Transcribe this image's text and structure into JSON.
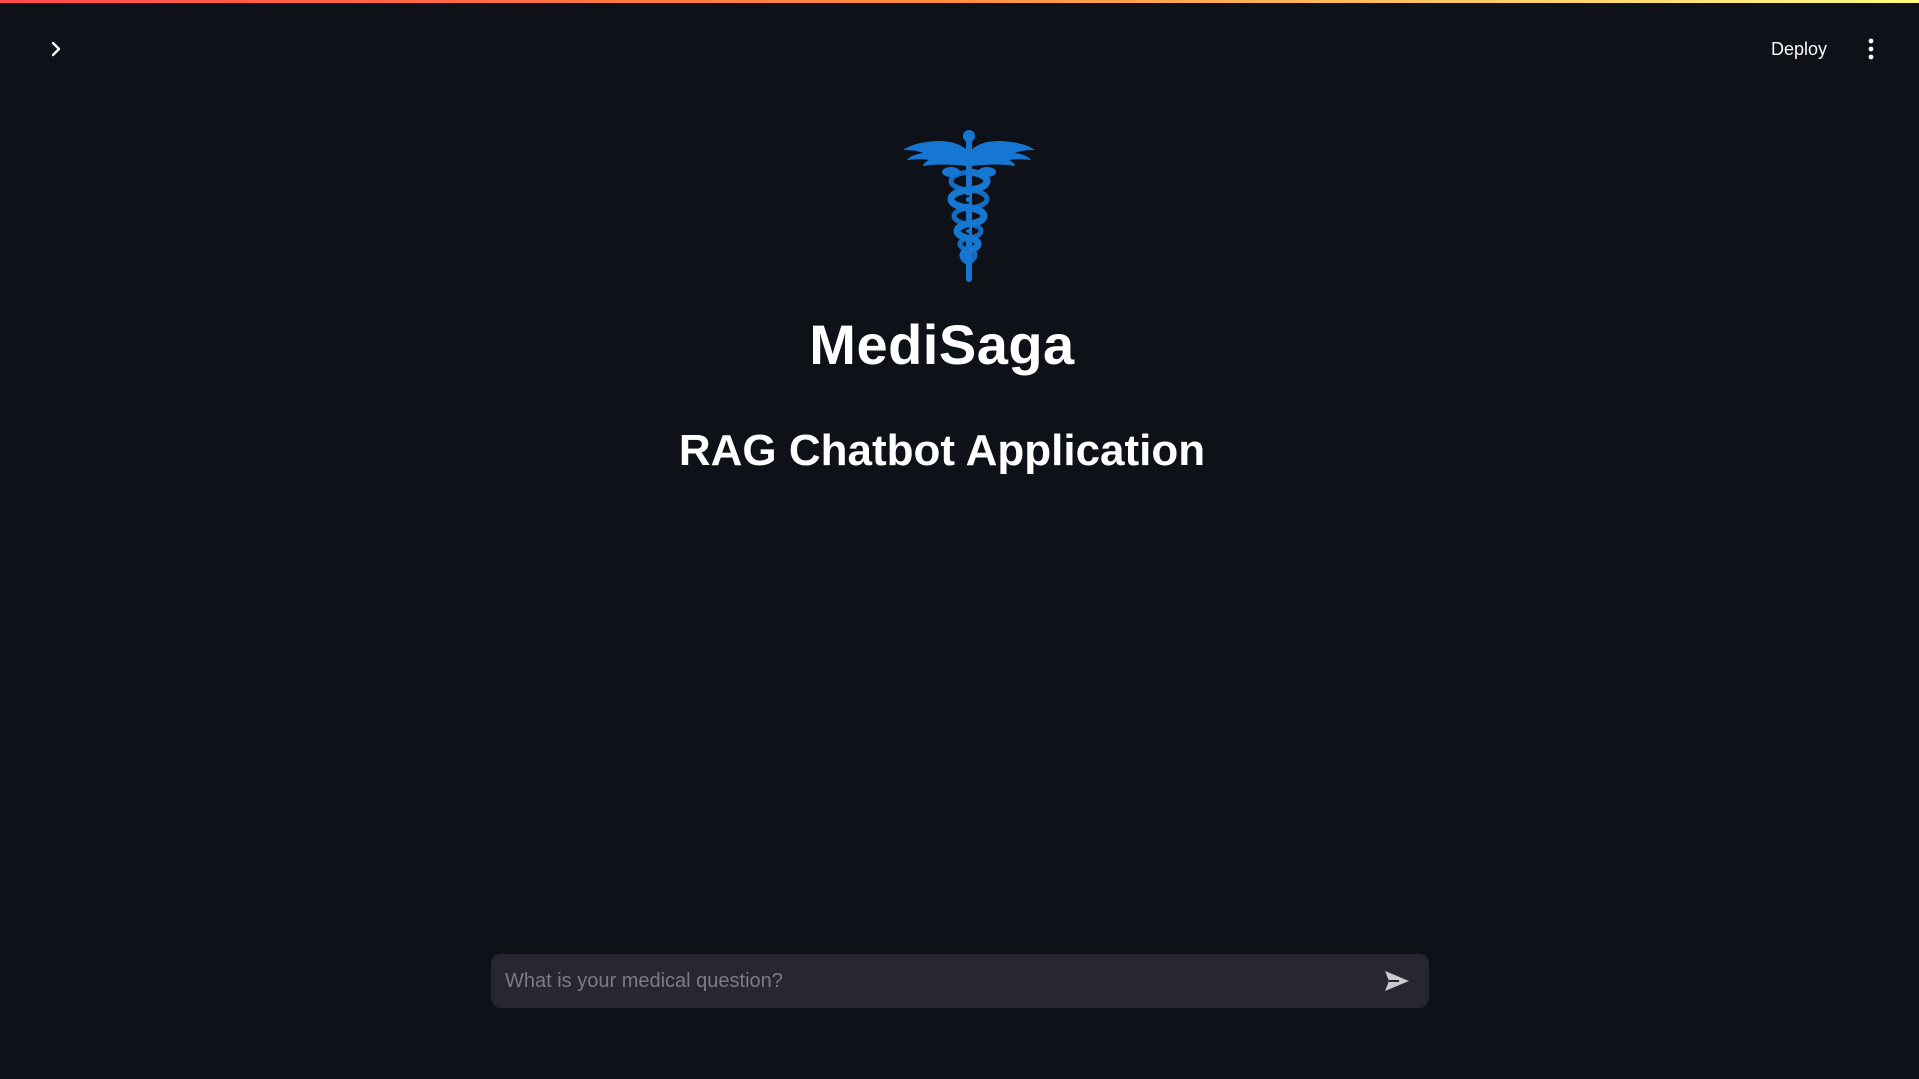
{
  "header": {
    "deploy_label": "Deploy",
    "sidebar_toggle_icon": "chevron-right-icon",
    "menu_icon": "kebab-menu-icon"
  },
  "main": {
    "logo_icon": "caduceus-icon",
    "title": "MediSaga",
    "subtitle": "RAG Chatbot Application"
  },
  "chat": {
    "placeholder": "What is your medical question?",
    "value": "",
    "send_icon": "send-icon"
  },
  "colors": {
    "background": "#0e1118",
    "logo": "#1677d2",
    "input_background": "#262730",
    "accent_gradient_start": "#ff4b4b",
    "accent_gradient_end": "#fffd80"
  }
}
